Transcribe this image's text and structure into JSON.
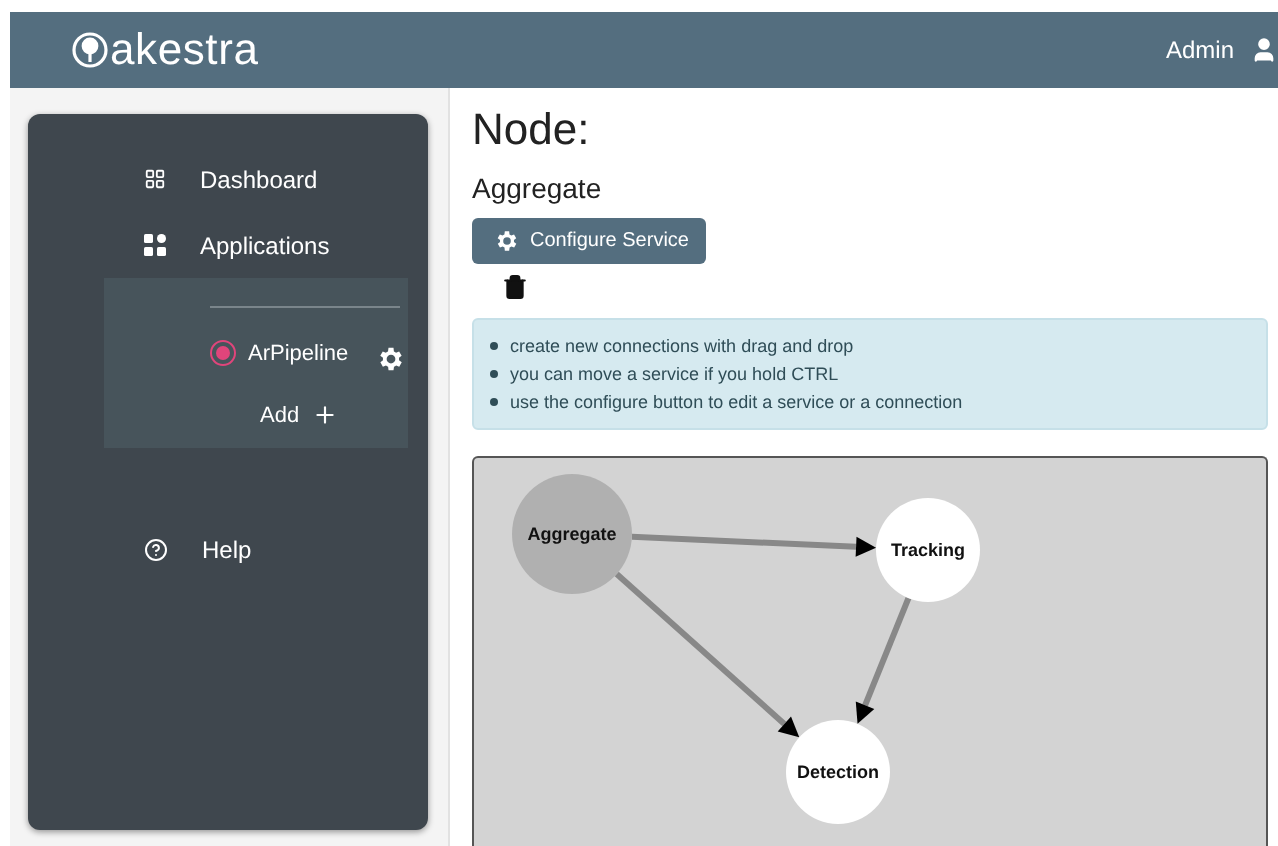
{
  "header": {
    "logo": "akestra",
    "user": "Admin"
  },
  "sidebar": {
    "items": [
      {
        "kind": "dashboard",
        "label": "Dashboard"
      },
      {
        "kind": "applications",
        "label": "Applications",
        "expanded": true,
        "children": [
          {
            "name": "ArPipeline",
            "selected": true
          }
        ],
        "add_label": "Add"
      },
      {
        "kind": "help",
        "label": "Help"
      }
    ]
  },
  "node": {
    "title": "Node:",
    "name": "Aggregate",
    "configure_button": "Configure Service"
  },
  "hints": [
    "create new connections with drag and drop",
    "you can move a service if you hold CTRL",
    "use the configure button to edit a service or a connection"
  ],
  "graph": {
    "nodes": [
      {
        "label": "Aggregate",
        "selected": true
      },
      {
        "label": "Tracking",
        "selected": false
      },
      {
        "label": "Detection",
        "selected": false
      }
    ]
  }
}
